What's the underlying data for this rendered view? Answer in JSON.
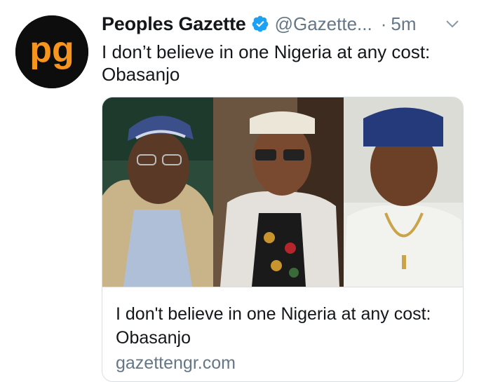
{
  "tweet": {
    "author_name": "Peoples Gazette",
    "handle": "@Gazette...",
    "separator": "·",
    "timestamp": "5m",
    "text": "I don’t believe in one Nigeria at any cost: Obasanjo",
    "avatar": {
      "logo_text": "pg",
      "bg_color": "#0d0d0d",
      "logo_color": "#f7941d"
    },
    "verified_badge": {
      "icon": "verified-icon",
      "color": "#1da1f2"
    },
    "menu_icon": "chevron-down-icon"
  },
  "card": {
    "title": "I don't believe in one Nigeria at any cost: Obasanjo",
    "domain": "gazettengr.com",
    "image": {
      "photos": [
        "photo-left",
        "photo-middle",
        "photo-right"
      ]
    }
  }
}
